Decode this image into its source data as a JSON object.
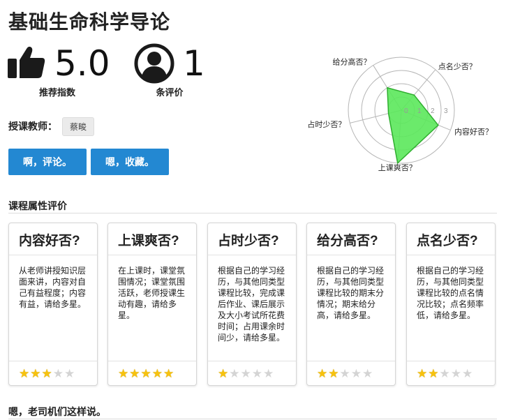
{
  "course": {
    "title": "基础生命科学导论",
    "rating": "5.0",
    "rating_label": "推荐指数",
    "review_count": "1",
    "review_label": "条评价",
    "teacher_label": "授课教师：",
    "teacher_name": "蔡畯"
  },
  "actions": {
    "comment_label": "啊，评论。",
    "favorite_label": "嗯，收藏。"
  },
  "icons": {
    "rating": "thumbs-up-icon",
    "reviews": "user-circle-icon",
    "star": "star-icon"
  },
  "colors": {
    "accent": "#2388d2",
    "radar_fill": "#5be85b",
    "radar_stroke": "#2fae2f",
    "star_on": "#f7c20e",
    "star_off": "#d4d4d4"
  },
  "radar": {
    "scale_labels": [
      "0",
      "1",
      "2",
      "3"
    ],
    "max": 4,
    "axes": [
      {
        "label": "点名少否？",
        "value": 1.5
      },
      {
        "label": "内容好否？",
        "value": 3
      },
      {
        "label": "上课爽否？",
        "value": 4
      },
      {
        "label": "占时少否？",
        "value": 1
      },
      {
        "label": "给分高否？",
        "value": 2
      }
    ]
  },
  "attributes": {
    "title": "课程属性评价",
    "cards": [
      {
        "title": "内容好否?",
        "description": "从老师讲授知识层面来讲，内容对自己有益程度；内容有益，请给多星。",
        "stars": 3
      },
      {
        "title": "上课爽否?",
        "description": "在上课时，课堂氛围情况；课堂氛围活跃，老师授课生动有趣，请给多星。",
        "stars": 5
      },
      {
        "title": "占时少否?",
        "description": "根据自己的学习经历，与其他同类型课程比较，完成课后作业、课后展示及大小考试所花费时间；占用课余时间少，请给多星。",
        "stars": 1
      },
      {
        "title": "给分高否?",
        "description": "根据自己的学习经历，与其他同类型课程比较的期末分情况；期末给分高，请给多星。",
        "stars": 2
      },
      {
        "title": "点名少否?",
        "description": "根据自己的学习经历，与其他同类型课程比较的点名情况比较；点名频率低，请给多星。",
        "stars": 2
      }
    ]
  },
  "comments": {
    "title": "嗯，老司机们这样说。"
  }
}
